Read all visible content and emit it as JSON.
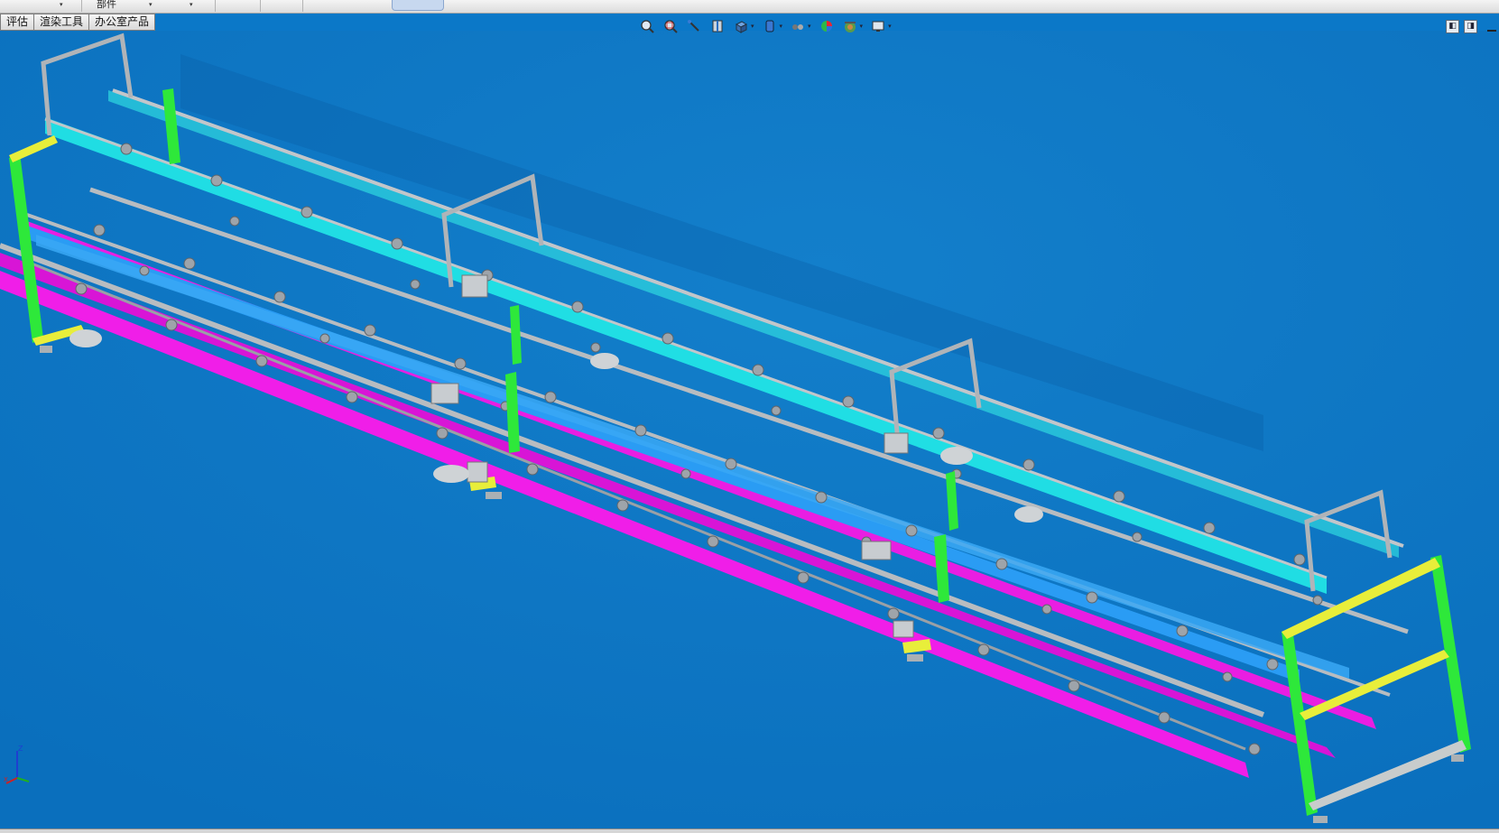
{
  "ribbon_strip": {
    "parts_label": "部件"
  },
  "tabs": [
    {
      "label": "评估"
    },
    {
      "label": "渲染工具"
    },
    {
      "label": "办公室产品"
    }
  ],
  "view_toolbar": {
    "icons": [
      "zoom-to-fit-icon",
      "zoom-to-area-icon",
      "previous-view-icon",
      "section-view-icon",
      "view-orientation-icon",
      "display-style-icon",
      "hide-show-items-icon",
      "edit-appearance-icon",
      "apply-scene-icon",
      "view-settings-icon"
    ]
  },
  "window_controls": {
    "icons": [
      "viewport-split-icon",
      "viewport-restore-icon",
      "viewport-minimize-icon"
    ]
  },
  "triad": {
    "axes": [
      "Z",
      "X"
    ]
  },
  "colors": {
    "viewport_background": "#0b78c8",
    "frame_green": "#2ee83a",
    "rail_cyan": "#22e6e6",
    "rail_blue": "#2a9cf4",
    "rail_magenta": "#f01ee8",
    "steel_gray": "#b8bcc0",
    "accent_yellow": "#e8ee3a"
  }
}
